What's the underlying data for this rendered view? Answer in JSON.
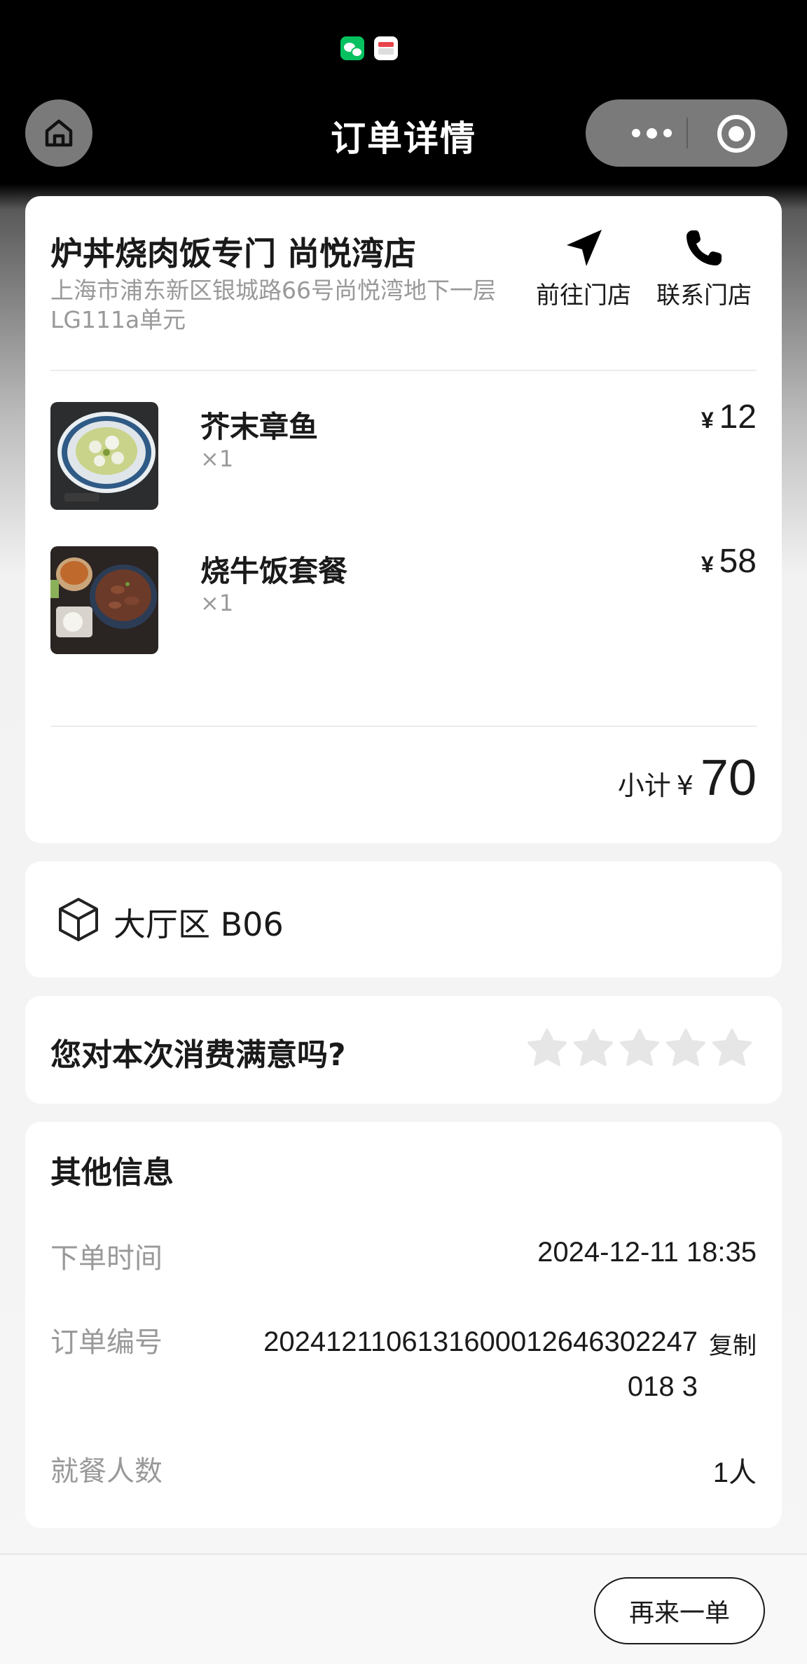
{
  "nav": {
    "title": "订单详情"
  },
  "store": {
    "name": "炉丼烧肉饭专门 尚悦湾店",
    "address": "上海市浦东新区银城路66号尚悦湾地下一层LG111a单元",
    "actions": [
      {
        "label": "前往门店",
        "icon": "navigation-arrow-icon"
      },
      {
        "label": "联系门店",
        "icon": "phone-icon"
      }
    ]
  },
  "items": [
    {
      "name": "芥末章鱼",
      "qty": "×1",
      "currency": "¥",
      "price": "12",
      "image": "wasabi-octopus-photo"
    },
    {
      "name": "烧牛饭套餐",
      "qty": "×1",
      "currency": "¥",
      "price": "58",
      "image": "beef-rice-set-photo"
    }
  ],
  "subtotal": {
    "label": "小计",
    "currency": "¥",
    "amount": "70"
  },
  "table": {
    "text": "大厅区 B06",
    "icon": "package-box-icon"
  },
  "rating": {
    "question": "您对本次消费满意吗?",
    "stars": 5,
    "selected": 0
  },
  "info": {
    "title": "其他信息",
    "order_time_label": "下单时间",
    "order_time": "2024-12-11 18:35",
    "order_no_label": "订单编号",
    "order_no": "2024121106131600012646302247018 3",
    "copy_label": "复制",
    "diners_label": "就餐人数",
    "diners": "1人"
  },
  "footer": {
    "reorder_label": "再来一单"
  },
  "colors": {
    "accent": "#1a1a1a",
    "muted": "#999999",
    "star_empty": "#e6e6e6",
    "wechat": "#07c160"
  }
}
